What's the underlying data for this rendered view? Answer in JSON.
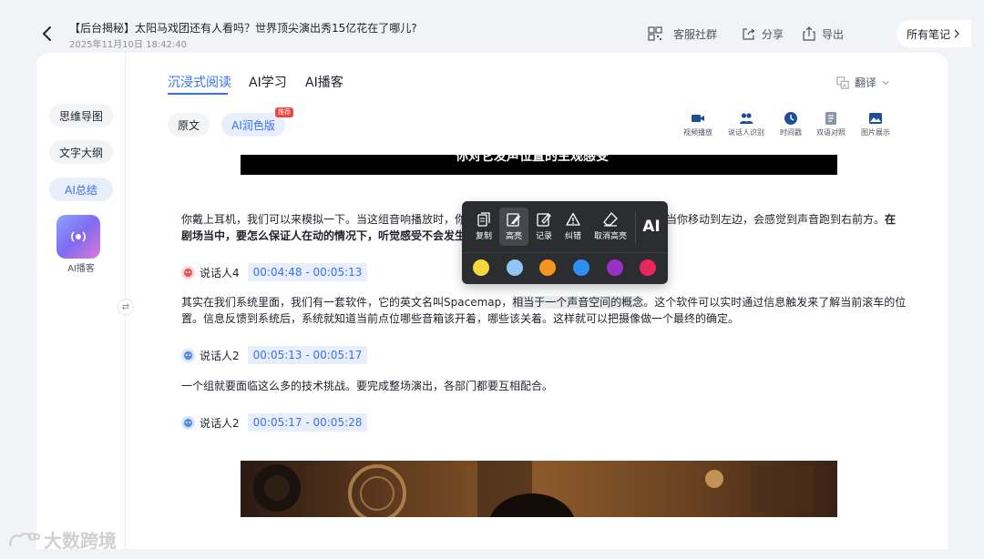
{
  "header": {
    "title": "【后台揭秘】太阳马戏团还有人看吗？世界顶尖演出秀15亿花在了哪儿?",
    "date": "2025年11月10日 18:42:40",
    "service_label": "客服社群",
    "share_label": "分享",
    "export_label": "导出",
    "all_notes_label": "所有笔记"
  },
  "sidebar": {
    "items": [
      {
        "label": "思维导图"
      },
      {
        "label": "文字大纲"
      },
      {
        "label": "AI总结"
      }
    ],
    "podcast_label": "AI播客",
    "collapse_glyph": "⇄"
  },
  "tabs": [
    {
      "label": "沉浸式阅读"
    },
    {
      "label": "AI学习"
    },
    {
      "label": "AI播客"
    }
  ],
  "translate_label": "翻译",
  "version": {
    "original_label": "原文",
    "ai_label": "AI润色版",
    "badge": "推荐"
  },
  "tools": [
    {
      "label": "视频播放",
      "icon": "video-icon"
    },
    {
      "label": "说话人识别",
      "icon": "people-icon"
    },
    {
      "label": "时间戳",
      "icon": "clock-icon"
    },
    {
      "label": "双语对照",
      "icon": "bilingual-icon"
    },
    {
      "label": "图片展示",
      "icon": "image-icon"
    }
  ],
  "banner_text": "你对它发声位置的主观感受",
  "transcript": {
    "p1_line1_a": "你戴上耳机，我们可以来模拟一下。当这组音响播放时，你",
    "p1_line1_b": "当你移动到左边，会感觉到声音跑到右前方。",
    "p1_line1_bold": "在",
    "p1_line2_bold": "剧场当中，要怎么保证人在动的情况下，听觉感受不会发生",
    "s1_name": "说话人4",
    "s1_time": "00:04:48 - 00:05:13",
    "p2_pre": "其实在我们系统里面，我们有一套软件，它的英文名叫Spacemap，",
    "p2_hl": "相当于一个声音空间的概念",
    "p2_post": "。这个软件可以实时通过信息触发来了解当前滚车的位",
    "p2_line2": "置。信息反馈到系统后，系统就知道当前点位哪些音箱该开着，哪些该关着。这样就可以把摄像做一个最终的确定。",
    "s2_name": "说话人2",
    "s2_time": "00:05:13 - 00:05:17",
    "p3": "一个组就要面临这么多的技术挑战。要完成整场演出，各部门都要互相配合。",
    "s3_name": "说话人2",
    "s3_time": "00:05:17 - 00:05:28"
  },
  "popup": {
    "copy_label": "复制",
    "highlight_label": "高亮",
    "note_label": "记录",
    "correct_label": "纠错",
    "unhighlight_label": "取消高亮",
    "ai_label": "AI",
    "colors": [
      "#f5d63d",
      "#8ec5f5",
      "#f5941f",
      "#2f8ff0",
      "#9b30c8",
      "#e8285c"
    ]
  },
  "watermark": "大数跨境"
}
